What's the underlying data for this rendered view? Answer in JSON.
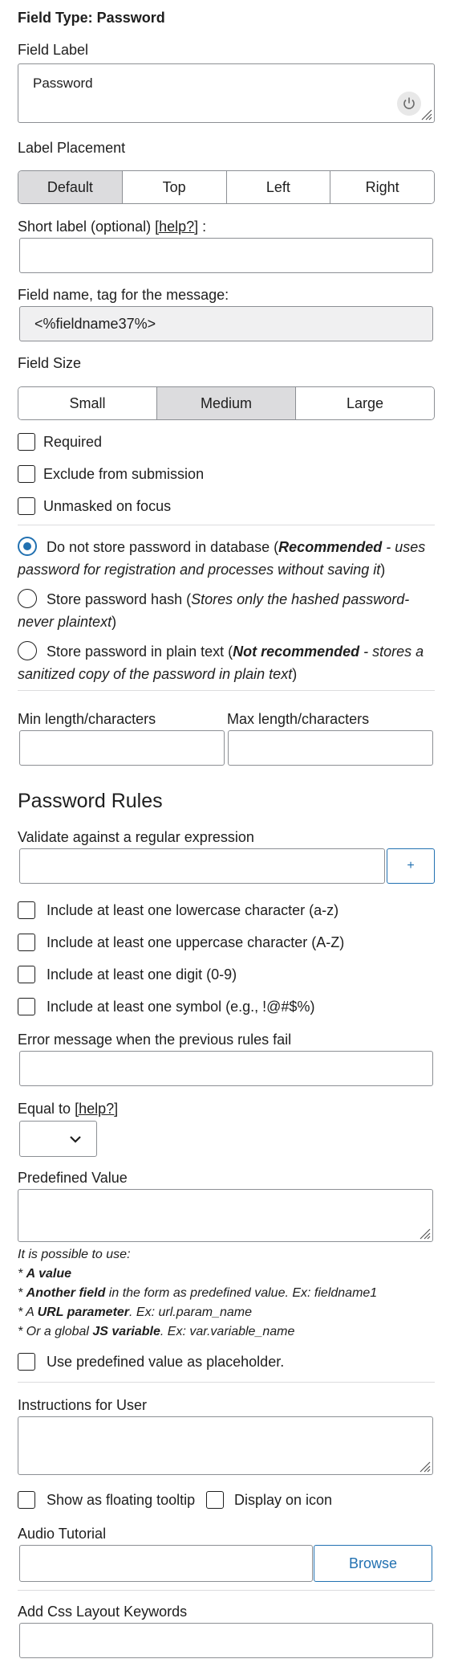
{
  "header": {
    "title": "Field Type: Password"
  },
  "field_label": {
    "label": "Field Label",
    "value": "Password"
  },
  "label_placement": {
    "label": "Label Placement",
    "options": [
      "Default",
      "Top",
      "Left",
      "Right"
    ],
    "selected": "Default"
  },
  "short_label": {
    "label": "Short label (optional) ",
    "help": "[help?]",
    "suffix": " :",
    "value": ""
  },
  "field_name": {
    "label": "Field name, tag for the message:",
    "value": "<%fieldname37%>"
  },
  "field_size": {
    "label": "Field Size",
    "options": [
      "Small",
      "Medium",
      "Large"
    ],
    "selected": "Medium"
  },
  "checks": {
    "required": "Required",
    "exclude": "Exclude from submission",
    "unmasked": "Unmasked on focus"
  },
  "storage": {
    "selected": "Do not store password in database",
    "opt1": {
      "name": "Do not store password in database (",
      "bold": "Recommended",
      "rest": " - uses password for registration and processes without saving it",
      "close": ")"
    },
    "opt2": {
      "name": "Store password hash (",
      "rest": "Stores only the hashed password- never plaintext",
      "close": ")"
    },
    "opt3": {
      "name": "Store password in plain text (",
      "bold": "Not recommended",
      "rest": " - stores a sanitized copy of the password in plain text",
      "close": ")"
    }
  },
  "length": {
    "min_label": "Min length/characters",
    "max_label": "Max length/characters",
    "min_value": "",
    "max_value": ""
  },
  "rules": {
    "heading": "Password Rules",
    "regex_label": "Validate against a regular expression",
    "regex_value": "",
    "add_button": "+",
    "lowercase": "Include at least one lowercase character (a-z)",
    "uppercase": "Include at least one uppercase character (A-Z)",
    "digit": "Include at least one digit (0-9)",
    "symbol": "Include at least one symbol (e.g., !@#$%)",
    "error_label": "Error message when the previous rules fail",
    "error_value": ""
  },
  "equal_to": {
    "label": "Equal to ",
    "help": "[help?]",
    "value": ""
  },
  "predefined": {
    "label": "Predefined Value",
    "value": "",
    "note_intro": "It is possible to use:",
    "note1_pre": "* ",
    "note1_bold": "A value",
    "note2_pre": "* ",
    "note2_bold": "Another field",
    "note2_rest": " in the form as predefined value. Ex: fieldname1",
    "note3_pre": "* A ",
    "note3_bold": "URL parameter",
    "note3_rest": ". Ex: url.param_name",
    "note4_pre": "* Or a global ",
    "note4_bold": "JS variable",
    "note4_rest": ". Ex: var.variable_name",
    "placeholder_check": "Use predefined value as placeholder."
  },
  "instructions": {
    "label": "Instructions for User",
    "value": "",
    "tooltip_check": "Show as floating tooltip",
    "icon_check": "Display on icon"
  },
  "audio": {
    "label": "Audio Tutorial",
    "value": "",
    "browse": "Browse"
  },
  "css": {
    "label": "Add Css Layout Keywords",
    "value": ""
  },
  "colors": {
    "accent": "#2271b1",
    "border": "#8c8f94",
    "segment_active": "#dcdcde",
    "readonly_bg": "#f0f0f1"
  }
}
